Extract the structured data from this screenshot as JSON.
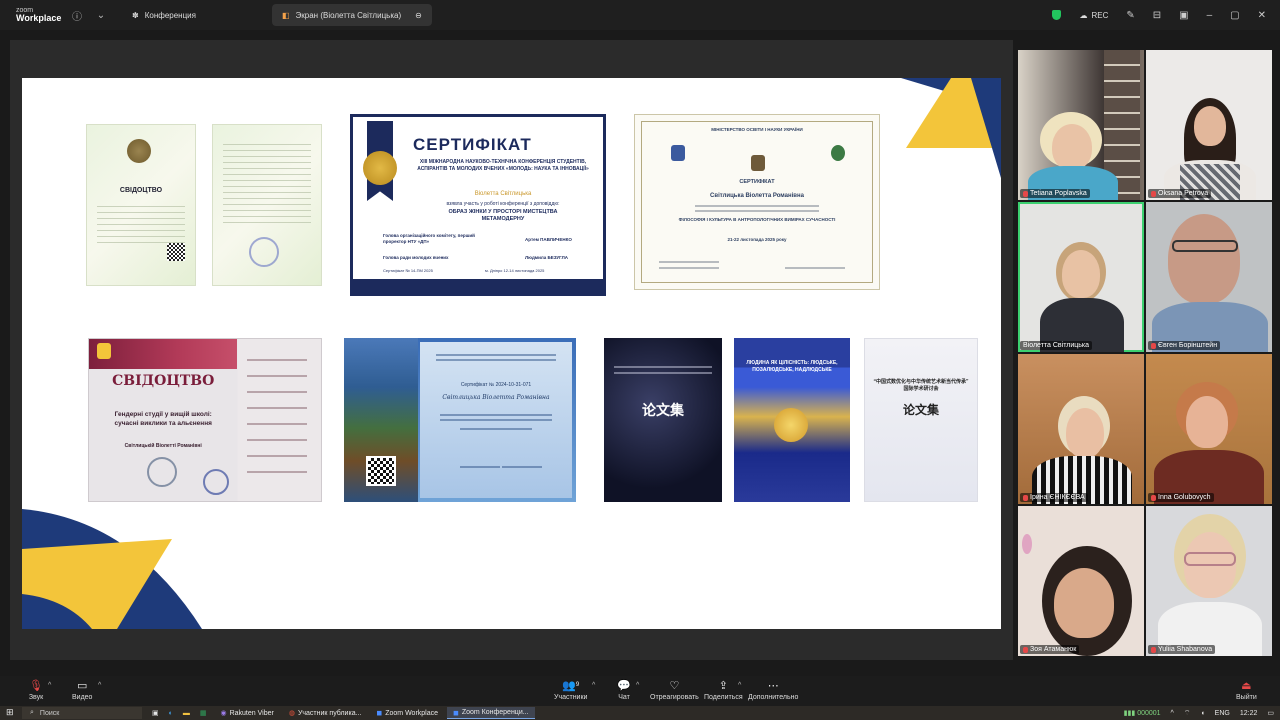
{
  "app": {
    "brand_line1": "zoom",
    "brand_line2": "Workplace"
  },
  "titlebar": {
    "tabs": [
      {
        "label": "Конференция",
        "icon": "paw-icon"
      },
      {
        "label": "Экран (Віолетта Світлицька)",
        "icon": "screen-icon"
      }
    ],
    "rec_label": "REC"
  },
  "slide": {
    "cert1_title": "СВІДОЦТВО",
    "cert2": {
      "title": "СЕРТИФІКАТ",
      "subtitle": "XIII МІЖНАРОДНА НАУКОВО-ТЕХНІЧНА КОНФЕРЕНЦІЯ СТУДЕНТІВ, АСПІРАНТІВ ТА МОЛОДИХ ВЧЕНИХ «МОЛОДЬ: НАУКА ТА ІННОВАЦІЇ»",
      "name": "Віолетта Світлицька",
      "body": "взявла участь у роботі конференції з доповіддю:",
      "topic": "ОБРАЗ ЖІНКИ У ПРОСТОРІ МИСТЕЦТВА МЕТАМОДЕРНУ",
      "chair": "Голова організаційного комітету, перший проректор НТУ «ДП»",
      "chair_name": "Артем ПАВЛИЧЕНКО",
      "youth": "Голова ради молодих вчених",
      "youth_name": "Людмила БЕЗУГЛА",
      "number": "Сертифікат № 14-ПМ 2025",
      "place": "м. Дніпро 12-14 листопада 2025"
    },
    "cert3": {
      "ministry": "МІНІСТЕРСТВО ОСВІТИ І НАУКИ УКРАЇНИ",
      "title": "СЕРТИФІКАТ",
      "name": "Світлицька Віолетта Романівна",
      "topic": "ФІЛОСОФІЯ І КУЛЬТУРА В АНТРОПОЛОГІЧНИХ ВИМІРАХ СУЧАСНОСТІ",
      "dates": "21-22 листопада 2025 року"
    },
    "svid": {
      "title": "СВІДОЦТВО",
      "topic": "Гендерні студії у вищій школі: сучасні виклики та альєнення",
      "name": "Світлицькій Віолетті Романівні"
    },
    "bluecert": {
      "number": "Сертифікат № 2024-10-31-071",
      "name": "Світлицька Віолетта Романівна"
    },
    "book1_title": "论文集",
    "book2_title": "ЛЮДИНА ЯК ЦІЛІСНІСТЬ: ЛЮДСЬКЕ, ПОЗАЛЮДСЬКЕ, НАДЛЮДСЬКЕ",
    "book3_title": "论文集",
    "book3_head": "“中国式数优化与中华传统艺术新当代传承” 国际学术研讨会"
  },
  "participants": [
    {
      "name": "Tetiana Poplavska",
      "muted": true
    },
    {
      "name": "Oksana Petrova",
      "muted": true
    },
    {
      "name": "Віолетта Світлицька",
      "muted": false
    },
    {
      "name": "Євген Борінштейн",
      "muted": true
    },
    {
      "name": "Ірина ЄНІКЄЄВА",
      "muted": true
    },
    {
      "name": "Inna Golubovych",
      "muted": true
    },
    {
      "name": "Зоя Атаманюк",
      "muted": true
    },
    {
      "name": "Yuliia Shabanova",
      "muted": true
    }
  ],
  "toolbar": {
    "audio": "Звук",
    "video": "Видео",
    "participants": "Участники",
    "participants_count": "9",
    "chat": "Чат",
    "react": "Отреагировать",
    "share": "Поделиться",
    "more": "Дополнительно",
    "leave": "Выйти"
  },
  "taskbar": {
    "search": "Поиск",
    "tasks": [
      "Rakuten Viber",
      "Участник публика...",
      "Zoom Workplace",
      "Zoom Конференци..."
    ],
    "stock": "000001",
    "lang": "ENG",
    "time": "12:22"
  }
}
